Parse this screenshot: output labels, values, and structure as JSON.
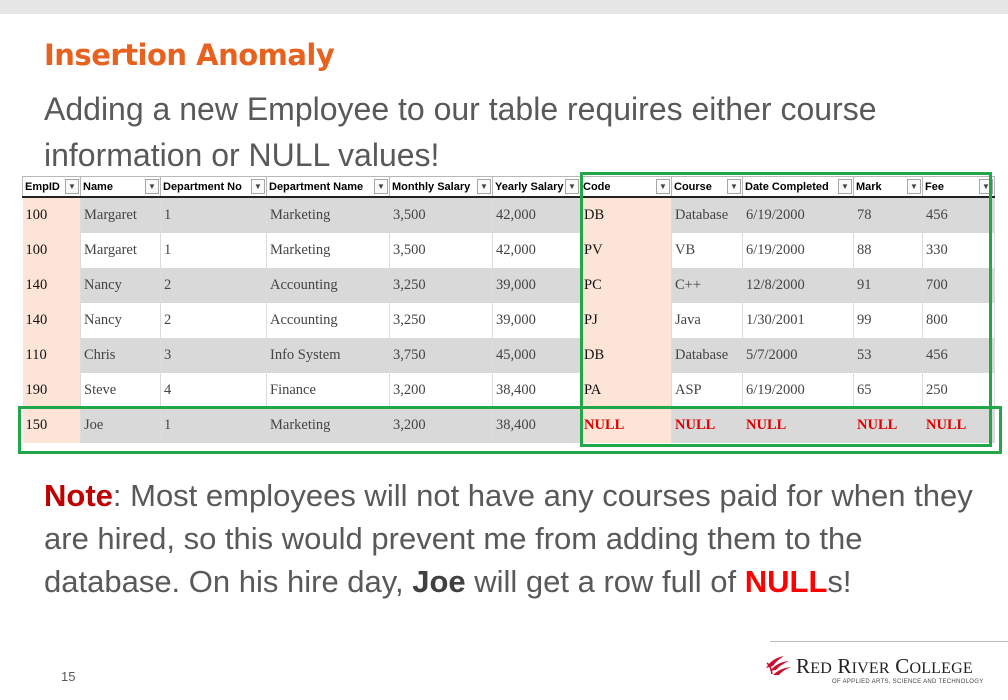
{
  "slide": {
    "title": "Insertion Anomaly",
    "subtitle": "Adding a new Employee to our table requires either course information or NULL values!",
    "note": {
      "lead": "Note",
      "part1": ": Most employees will not have any courses paid for when they are hired, so this would prevent me from adding them to the database. On his hire day, ",
      "joe": "Joe",
      "part2": " will get a row full of ",
      "nul": "NULL",
      "part3": "s!"
    },
    "page_number": "15",
    "logo": {
      "name_r": "R",
      "name_ed": "ED",
      "name_r2": "R",
      "name_iver": "IVER",
      "name_c": "C",
      "name_ollege": "OLLEGE",
      "tagline": "OF APPLIED ARTS, SCIENCE AND TECHNOLOGY"
    }
  },
  "table": {
    "columns": [
      "EmpID",
      "Name",
      "Department No",
      "Department Name",
      "Monthly Salary",
      "Yearly Salary",
      "Code",
      "Course",
      "Date Completed",
      "Mark",
      "Fee"
    ],
    "dropdown_glyph": "▼",
    "rows": [
      [
        "100",
        "Margaret",
        "1",
        "Marketing",
        "3,500",
        "42,000",
        "DB",
        "Database",
        "6/19/2000",
        "78",
        "456"
      ],
      [
        "100",
        "Margaret",
        "1",
        "Marketing",
        "3,500",
        "42,000",
        "PV",
        "VB",
        "6/19/2000",
        "88",
        "330"
      ],
      [
        "140",
        "Nancy",
        "2",
        "Accounting",
        "3,250",
        "39,000",
        "PC",
        "C++",
        "12/8/2000",
        "91",
        "700"
      ],
      [
        "140",
        "Nancy",
        "2",
        "Accounting",
        "3,250",
        "39,000",
        "PJ",
        "Java",
        "1/30/2001",
        "99",
        "800"
      ],
      [
        "110",
        "Chris",
        "3",
        "Info System",
        "3,750",
        "45,000",
        "DB",
        "Database",
        "5/7/2000",
        "53",
        "456"
      ],
      [
        "190",
        "Steve",
        "4",
        "Finance",
        "3,200",
        "38,400",
        "PA",
        "ASP",
        "6/19/2000",
        "65",
        "250"
      ],
      [
        "150",
        "Joe",
        "1",
        "Marketing",
        "3,200",
        "38,400",
        "NULL",
        "NULL",
        "NULL",
        "NULL",
        "NULL"
      ]
    ]
  },
  "colors": {
    "title": "#e8621f",
    "highlight_box": "#22a64a",
    "null_text": "#e00000",
    "note_lead": "#c00000",
    "key_column_fill": "#fce4d6"
  }
}
